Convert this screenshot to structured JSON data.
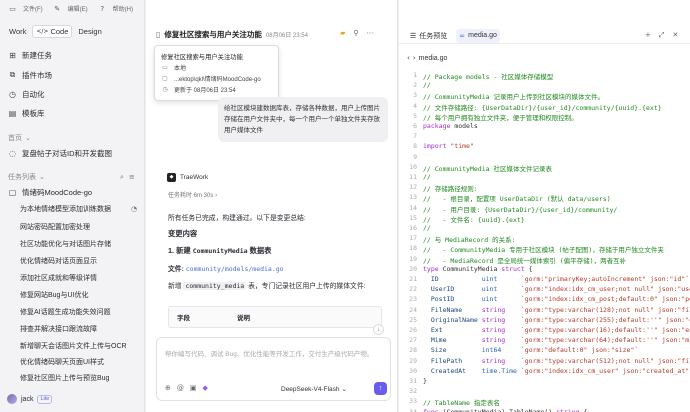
{
  "menubar": {
    "file": "文件(F)",
    "edit": "编辑(E)",
    "help": "帮助(H)"
  },
  "modes": [
    "Work",
    "Code",
    "Design"
  ],
  "sidebar": {
    "nav": [
      "新建任务",
      "插件市场",
      "自动化",
      "模板库"
    ],
    "home_label": "首页",
    "home_item": "复盘帖子对话ID和开发截图",
    "tasklist_label": "任务列表",
    "group": "情绪码MoodCode-go",
    "tasks": [
      "为本地情绪模型添加训练数据",
      "网站密码配置加密处理",
      "社区功能优化与对话图片存储",
      "优化情绪码对话页面显示",
      "添加社区成就和等级详情",
      "修复网站Bug与UI优化",
      "修复AI话题生成功能失效问题",
      "排查并解决接口跟流故障",
      "新增聊天会话图片文件上传与OCR",
      "优化情绪码聊天页面UI样式",
      "修复社区图片上传与预览Bug"
    ],
    "user": "jack",
    "badge": "Lite"
  },
  "chat": {
    "title": "修复社区搜索与用户关注功能",
    "date": "08月06日 23:54",
    "popover": {
      "title": "修复社区搜索与用户关注功能",
      "local": "本地",
      "path": "...ektop\\qkl\\情绪码MoodCode-go",
      "updated": "更新于 08月06日 23:54"
    },
    "user_msg": "给社区模块建数据库表，存储各种数据，用户上传图片存储在用户文件夹中，每一个用户一个单独文件夹存放用户媒体文件",
    "ai_name": "TraeWork",
    "elapsed": "任务耗时 6m 30s",
    "done": "所有任务已完成，构建通过。以下是变更总结:",
    "changes_title": "变更内容",
    "section1_prefix": "1. 新建",
    "section1_code": "CommunityMedia",
    "section1_suffix": "数据表",
    "file_label": "文件:",
    "file_path": "community/models/media.go",
    "desc_prefix": "新增",
    "desc_code": "community_media",
    "desc_suffix": "表，专门记录社区用户上传的媒体文件:",
    "table_headers": [
      "字段",
      "说明"
    ],
    "input_placeholder": "帮你编写代码、调试 Bug、优化性能等开发工作，交付生产级代码产物。",
    "model": "DeepSeek-V4-Flash"
  },
  "editor": {
    "tabs": [
      "任务预览",
      "media.go"
    ],
    "filename": "media.go"
  },
  "code_lines": [
    "// Package models - 社区媒体存储模型",
    "//",
    "// CommunityMedia 记录用户上传到社区模块的媒体文件。",
    "// 文件存储路径: {UserDataDir}/{user_id}/community/{uuid}.{ext}",
    "// 每个用户拥有独立文件夹，便于管理和权限控制。",
    "package models",
    "",
    "import \"time\"",
    "",
    "// CommunityMedia 社区媒体文件记录表",
    "//",
    "// 存储路径规则:",
    "//   - 根目录，配置项 UserDataDir (默认 data/users)",
    "//   - 用户目录: {UserDataDir}/{user_id}/community/",
    "//   - 文件名: {uuid}.{ext}",
    "//",
    "// 与 MediaRecord 的关系:",
    "//   - CommunityMedia 专用于社区模块 (帖子配图)，存储于用户独立文件夹",
    "//   - MediaRecord 是全局统一媒体索引 (偏平存储)，两者互补",
    "type CommunityMedia struct {",
    "\tID           uint      `gorm:\"primaryKey;autoIncrement\" json:\"id\"`",
    "\tUserID       uint      `gorm:\"index:idx_cm_user;not null\" json:\"user_id\"`",
    "\tPostID       uint      `gorm:\"index:idx_cm_post;default:0\" json:\"post_id\"`",
    "\tFileName     string    `gorm:\"type:varchar(128);not null\" json:\"file_name\"`",
    "\tOriginalName string    `gorm:\"type:varchar(255);default:''\" json:\"original_name\"`",
    "\tExt          string    `gorm:\"type:varchar(16);default:''\" json:\"ext\"`",
    "\tMime         string    `gorm:\"type:varchar(64);default:''\" json:\"mime\"`",
    "\tSize         int64     `gorm:\"default:0\" json:\"size\"`",
    "\tFilePath     string    `gorm:\"type:varchar(512);not null\" json:\"file_path\"`",
    "\tCreatedAt    time.Time `gorm:\"index:idx_cm_user\" json:\"created_at\"`",
    "}",
    "",
    "// TableName 指定表名",
    "func (CommunityMedia) TableName() string {"
  ]
}
